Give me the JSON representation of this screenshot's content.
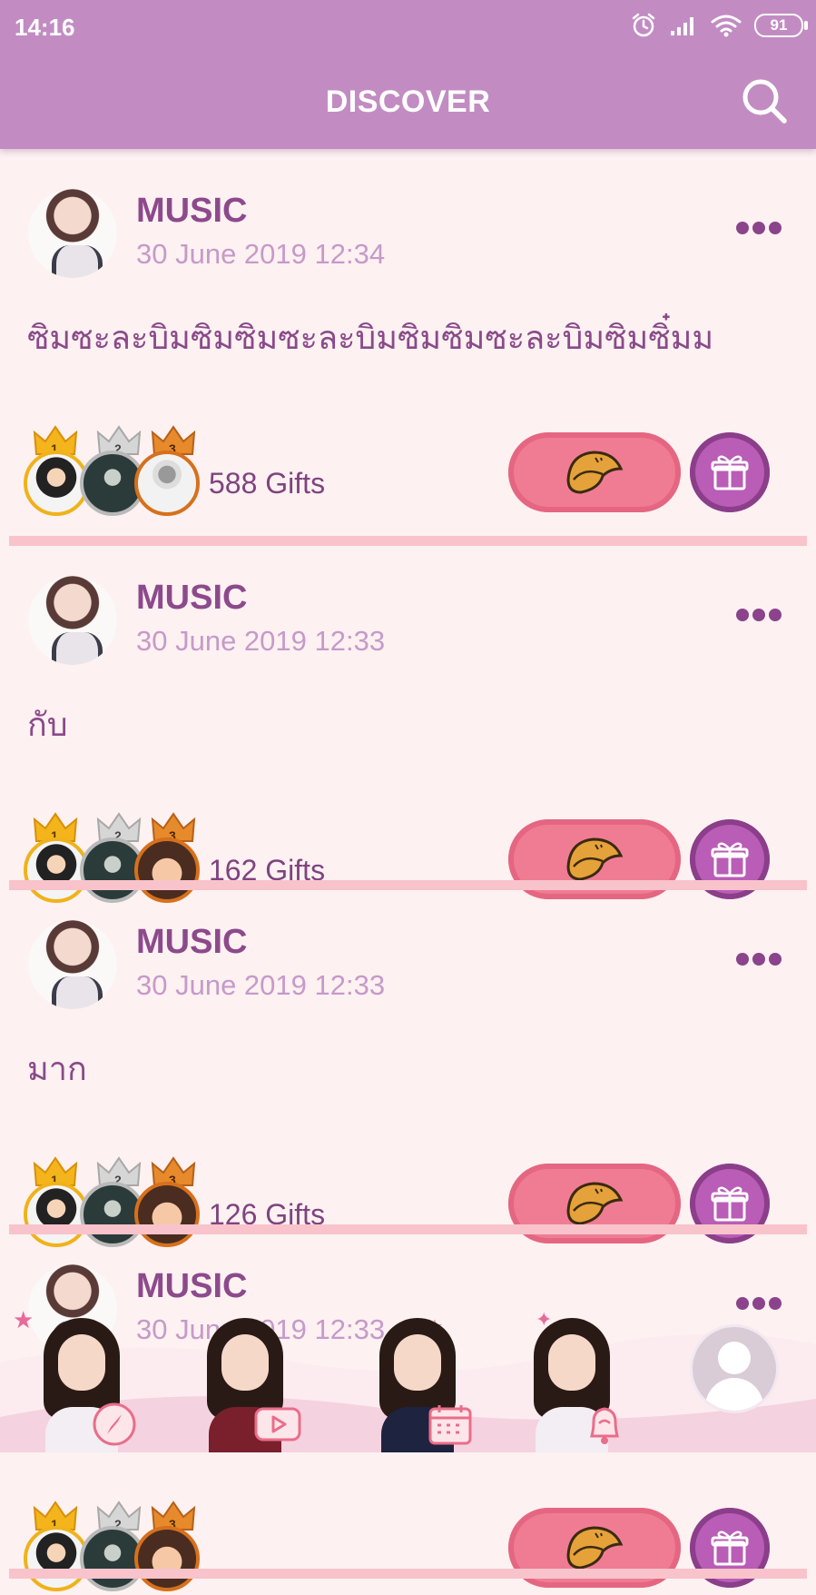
{
  "status_bar": {
    "time": "14:16",
    "battery": "91"
  },
  "header": {
    "title": "DISCOVER"
  },
  "posts": [
    {
      "author": "MUSIC",
      "date": "30 June 2019 12:34",
      "text": "ซิมซะละบิมซิมซิมซะละบิมซิมซิมซะละบิมซิมซิ๋มม",
      "gifts": "588 Gifts",
      "third_gifter": "sketch"
    },
    {
      "author": "MUSIC",
      "date": "30 June 2019 12:33",
      "text": "กับ",
      "gifts": "162 Gifts",
      "third_gifter": "cartoon"
    },
    {
      "author": "MUSIC",
      "date": "30 June 2019 12:33",
      "text": "มาก",
      "gifts": "126 Gifts",
      "third_gifter": "cartoon"
    },
    {
      "author": "MUSIC",
      "date": "30 June 2019 12:33",
      "text": "",
      "gifts": "",
      "third_gifter": "cartoon"
    }
  ],
  "ranks": [
    "1",
    "2",
    "3"
  ],
  "icons": {
    "status": [
      "alarm-icon",
      "signal-icon",
      "wifi-icon",
      "battery-icon"
    ],
    "header": "search-icon",
    "post_actions": [
      "more-icon",
      "fortune-cookie-icon",
      "gift-icon"
    ],
    "nav": [
      "compass-icon",
      "play-icon",
      "calendar-icon",
      "bell-icon",
      "profile-icon"
    ]
  },
  "colors": {
    "header": "#c28cc3",
    "background": "#fdf1f1",
    "accent_purple": "#8c4a8c",
    "date_lilac": "#c69ac9",
    "cookie_button": "#f07c93",
    "gift_button": "#b95db6",
    "divider": "#f8c3cb"
  }
}
